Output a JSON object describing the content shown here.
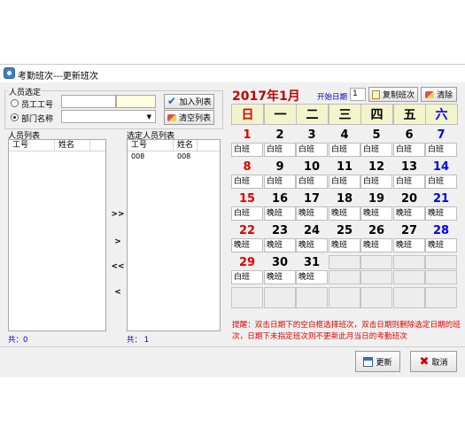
{
  "window": {
    "title": "考勤班次---更新班次"
  },
  "person_select": {
    "legend": "人员选定",
    "employee_id_label": "员工工号",
    "department_label": "部门名称"
  },
  "buttons": {
    "add_to_list": "加入列表",
    "clear_list": "清空列表",
    "copy_shift": "复制班次",
    "clear": "清除",
    "update": "更新",
    "cancel": "取消",
    "move_all_right": ">>",
    "move_right": ">",
    "move_all_left": "<<",
    "move_left": "<"
  },
  "people_list": {
    "title": "人员列表",
    "columns": [
      "工号",
      "姓名"
    ],
    "rows": [],
    "count_label": "共：0"
  },
  "selected_list": {
    "title": "选定人员列表",
    "columns": [
      "工号",
      "姓名"
    ],
    "rows": [
      [
        "008",
        "008"
      ]
    ],
    "count_label": "共： 1"
  },
  "calendar": {
    "title": "2017年1月",
    "start_date_label": "开始日期",
    "start_date_value": "1",
    "weekdays": [
      "日",
      "一",
      "二",
      "三",
      "四",
      "五",
      "六"
    ],
    "weeks": [
      [
        [
          "1",
          "白班"
        ],
        [
          "2",
          "白班"
        ],
        [
          "3",
          "白班"
        ],
        [
          "4",
          "白班"
        ],
        [
          "5",
          "白班"
        ],
        [
          "6",
          "白班"
        ],
        [
          "7",
          "白班"
        ]
      ],
      [
        [
          "8",
          "白班"
        ],
        [
          "9",
          "白班"
        ],
        [
          "10",
          "白班"
        ],
        [
          "11",
          "白班"
        ],
        [
          "12",
          "白班"
        ],
        [
          "13",
          "白班"
        ],
        [
          "14",
          "白班"
        ]
      ],
      [
        [
          "15",
          "白班"
        ],
        [
          "16",
          "晚班"
        ],
        [
          "17",
          "晚班"
        ],
        [
          "18",
          "晚班"
        ],
        [
          "19",
          "晚班"
        ],
        [
          "20",
          "晚班"
        ],
        [
          "21",
          "晚班"
        ]
      ],
      [
        [
          "22",
          "晚班"
        ],
        [
          "23",
          "晚班"
        ],
        [
          "24",
          "晚班"
        ],
        [
          "25",
          "晚班"
        ],
        [
          "26",
          "晚班"
        ],
        [
          "27",
          "晚班"
        ],
        [
          "28",
          "晚班"
        ]
      ],
      [
        [
          "29",
          "白班"
        ],
        [
          "30",
          "晚班"
        ],
        [
          "31",
          "晚班"
        ],
        null,
        null,
        null,
        null
      ],
      [
        null,
        null,
        null,
        null,
        null,
        null,
        null
      ]
    ]
  },
  "hint": "提醒：双击日期下的空白框选择班次，双击日期则删除选定日期的班次，日期下未指定班次则不更新此月当日的考勤班次",
  "colors": {
    "sunday": "#e00000",
    "saturday": "#0000ee",
    "weekday": "#000000",
    "header_bg": "#f4f4cc",
    "title_red": "#c00000",
    "hint_red": "#e00000"
  }
}
